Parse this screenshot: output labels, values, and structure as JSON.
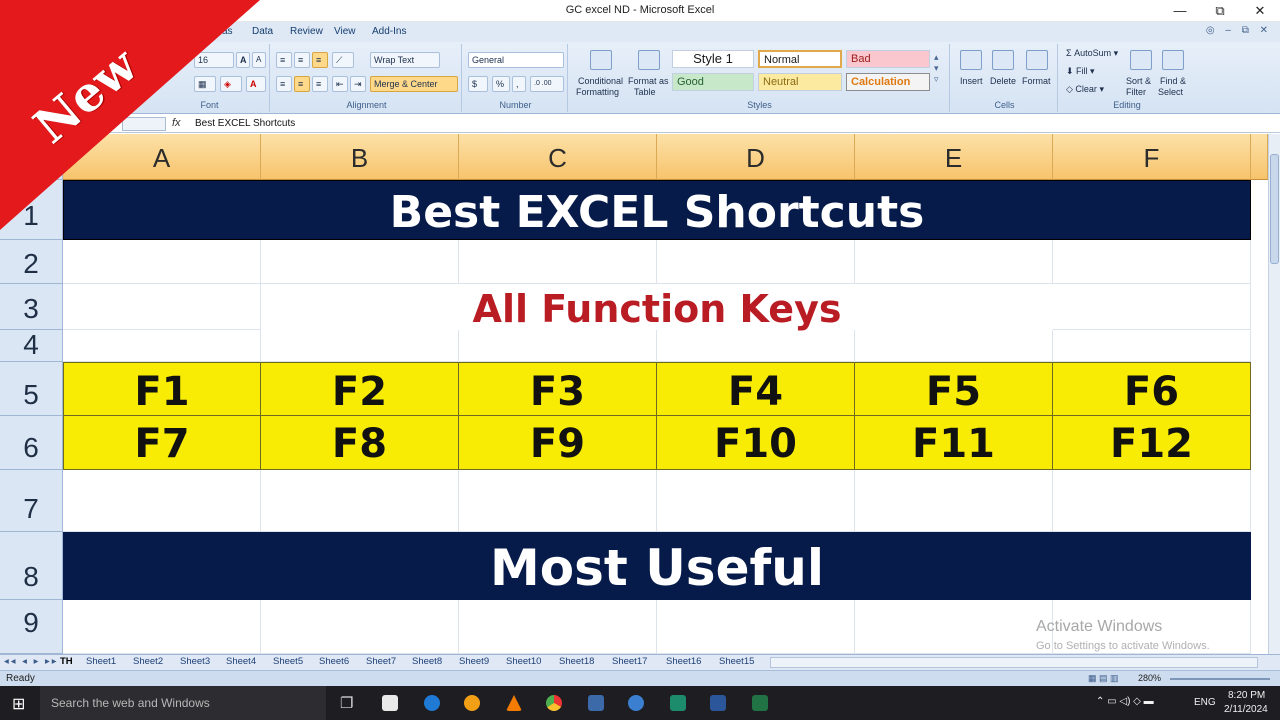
{
  "window": {
    "title": "GC excel ND - Microsoft Excel",
    "min": "—",
    "restore": "⧉",
    "close": "✕"
  },
  "menu": {
    "items": [
      "as",
      "Data",
      "Review",
      "View",
      "Add-Ins"
    ],
    "help": "◎ – ⧉ ✕"
  },
  "ribbon": {
    "font": {
      "size": "16",
      "grow": "A",
      "shrink": "A",
      "label": "Font"
    },
    "alignment": {
      "wrap_text": "Wrap Text",
      "merge_center": "Merge & Center",
      "label": "Alignment"
    },
    "number": {
      "format": "General",
      "currency": "$",
      "percent": "%",
      "comma": ",",
      "inc_dec": ".0 .00",
      "label": "Number"
    },
    "styles": {
      "conditional_formatting": [
        "Conditional",
        "Formatting"
      ],
      "format_as_table": [
        "Format as",
        "Table"
      ],
      "style1": "Style 1",
      "normal": "Normal",
      "bad": "Bad",
      "good": "Good",
      "neutral": "Neutral",
      "calculation": "Calculation",
      "label": "Styles"
    },
    "cells": {
      "insert": "Insert",
      "delete": "Delete",
      "format": "Format",
      "label": "Cells"
    },
    "editing": {
      "autosum": "AutoSum",
      "fill": "Fill",
      "clear": "Clear",
      "sort_filter": [
        "Sort &",
        "Filter"
      ],
      "find_select": [
        "Find &",
        "Select"
      ],
      "label": "Editing"
    }
  },
  "formula_bar": {
    "fx": "fx",
    "content": "Best EXCEL Shortcuts"
  },
  "columns": [
    "A",
    "B",
    "C",
    "D",
    "E",
    "F"
  ],
  "rows": [
    "1",
    "2",
    "3",
    "4",
    "5",
    "6",
    "7",
    "8",
    "9"
  ],
  "sheet": {
    "title": "Best EXCEL Shortcuts",
    "subtitle": "All Function Keys",
    "keys_row1": [
      "F1",
      "F2",
      "F3",
      "F4",
      "F5",
      "F6"
    ],
    "keys_row2": [
      "F7",
      "F8",
      "F9",
      "F10",
      "F11",
      "F12"
    ],
    "footer": "Most Useful"
  },
  "tabs": [
    "TH",
    "Sheet1",
    "Sheet2",
    "Sheet3",
    "Sheet4",
    "Sheet5",
    "Sheet6",
    "Sheet7",
    "Sheet8",
    "Sheet9",
    "Sheet10",
    "Sheet18",
    "Sheet17",
    "Sheet16",
    "Sheet15"
  ],
  "status": {
    "ready": "Ready",
    "zoom": "280%"
  },
  "watermark": {
    "line1": "Activate Windows",
    "line2": "Go to Settings to activate Windows."
  },
  "badge": {
    "text": "New"
  },
  "taskbar": {
    "search": "Search the web and Windows",
    "lang": "ENG",
    "time": "8:20 PM",
    "date": "2/11/2024"
  },
  "colors": {
    "dark_banner": "#061b4a",
    "key_fill": "#f8ec04",
    "subtitle_red": "#b91c23",
    "badge_red": "#e3191c"
  }
}
